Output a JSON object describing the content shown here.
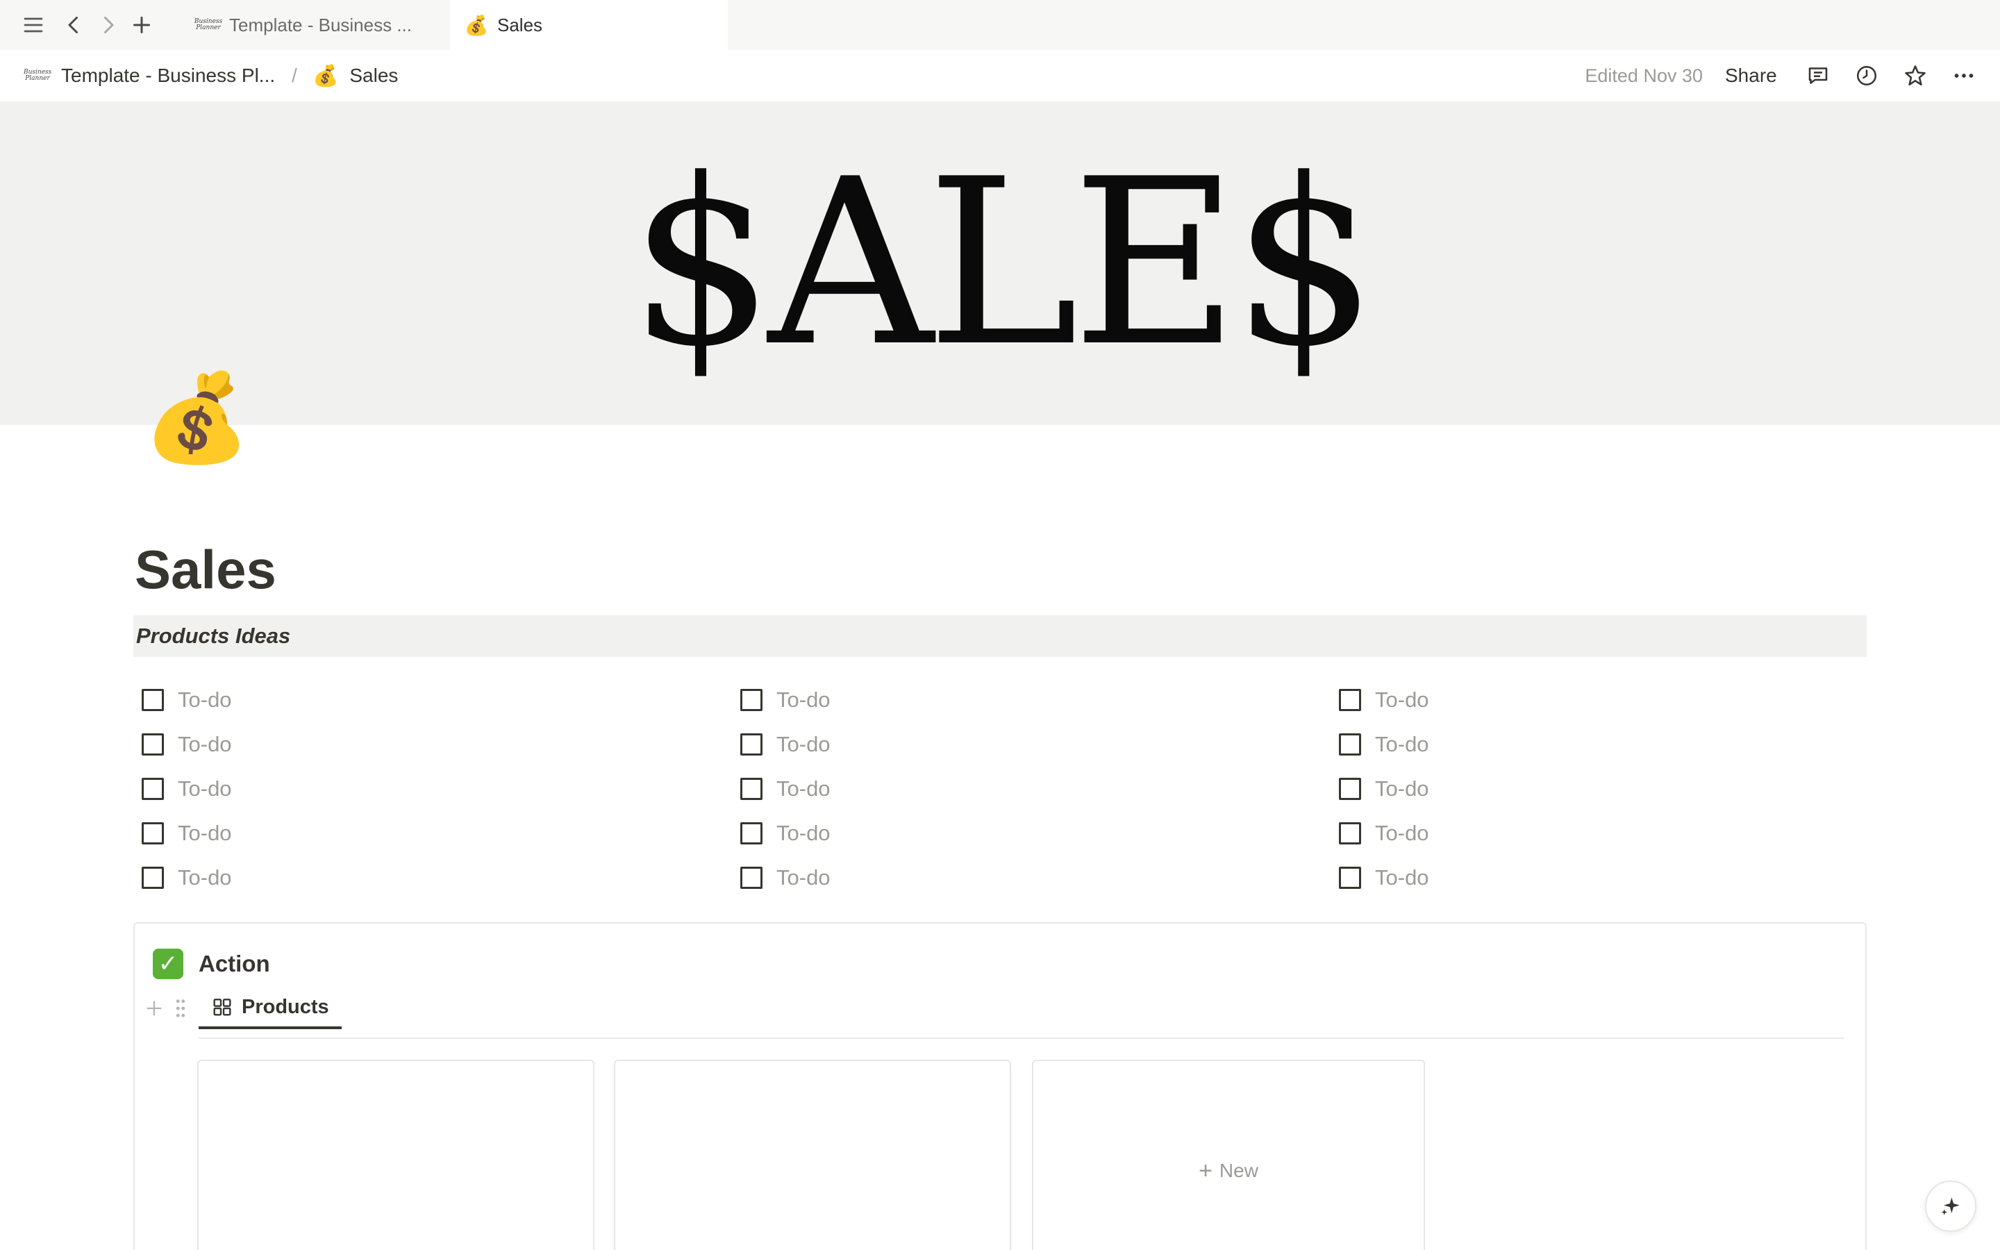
{
  "tabs": [
    {
      "label": "Template - Business ...",
      "icon": "business-planner-logo",
      "logo_text": "Business Planner",
      "active": false
    },
    {
      "label": "Sales",
      "icon": "💰",
      "active": true
    }
  ],
  "breadcrumb": {
    "parent": "Template - Business Pl...",
    "separator": "/",
    "current": "Sales",
    "current_icon": "💰",
    "parent_logo_text": "Business Planner"
  },
  "topbar": {
    "edited": "Edited Nov 30",
    "share_label": "Share",
    "icons": [
      "comment-icon",
      "history-icon",
      "star-icon",
      "more-icon"
    ]
  },
  "cover": {
    "text": "$ALE$"
  },
  "page": {
    "icon": "💰",
    "title": "Sales",
    "section_heading": "Products Ideas"
  },
  "todos": {
    "columns": [
      [
        "To-do",
        "To-do",
        "To-do",
        "To-do",
        "To-do"
      ],
      [
        "To-do",
        "To-do",
        "To-do",
        "To-do",
        "To-do"
      ],
      [
        "To-do",
        "To-do",
        "To-do",
        "To-do",
        "To-do"
      ]
    ]
  },
  "callout": {
    "icon": "✅",
    "title": "Action",
    "view_tab": "Products",
    "new_label": "New"
  },
  "colors": {
    "accent_text": "#37352f",
    "muted_text": "#9b9a97",
    "cover_bg": "#f1f1ef",
    "tabbar_bg": "#f7f7f5",
    "check_green": "#5bb135"
  }
}
